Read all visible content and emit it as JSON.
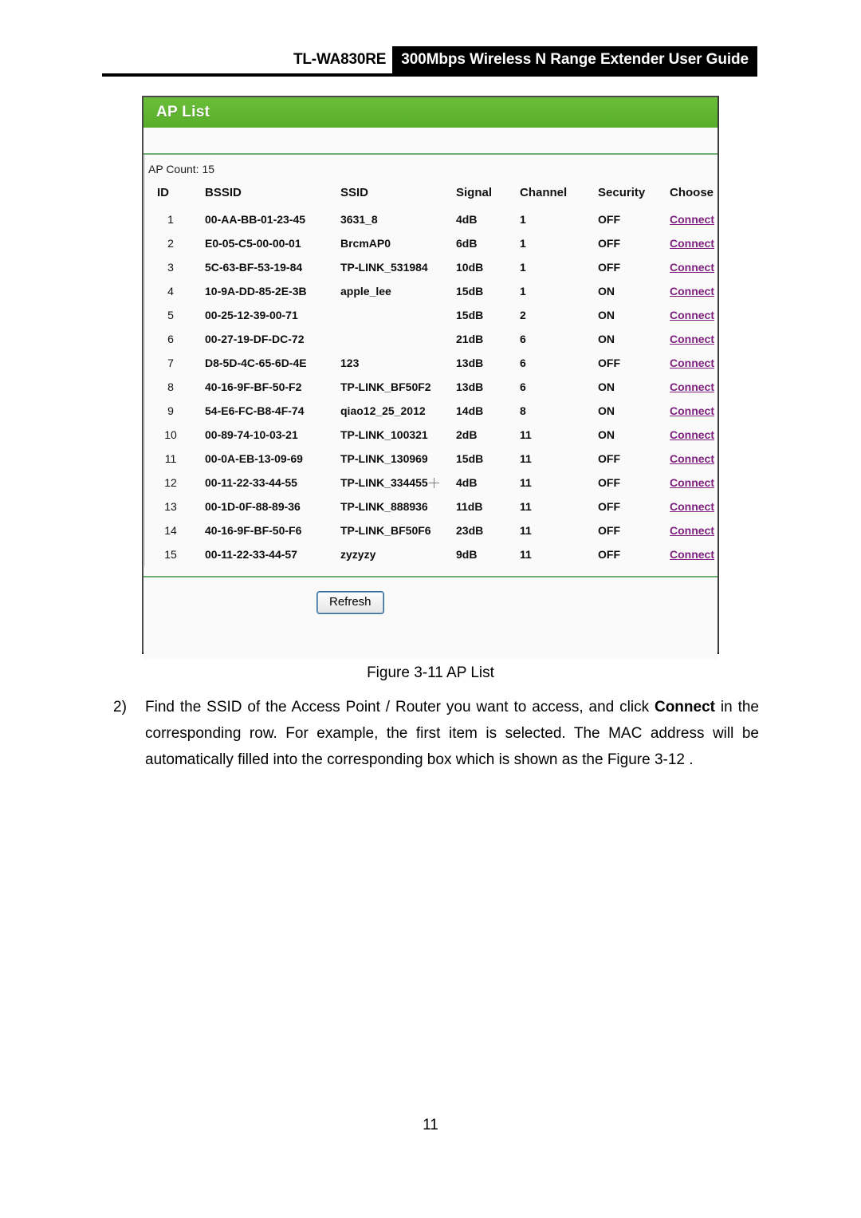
{
  "header": {
    "model": "TL-WA830RE",
    "title": "300Mbps Wireless N Range Extender User Guide"
  },
  "panel": {
    "title": "AP List",
    "ap_count_label": "AP Count: 15",
    "columns": {
      "id": "ID",
      "bssid": "BSSID",
      "ssid": "SSID",
      "signal": "Signal",
      "channel": "Channel",
      "security": "Security",
      "choose": "Choose"
    },
    "rows": [
      {
        "id": "1",
        "bssid": "00-AA-BB-01-23-45",
        "ssid": "3631_8",
        "signal": "4dB",
        "channel": "1",
        "security": "OFF",
        "choose": "Connect"
      },
      {
        "id": "2",
        "bssid": "E0-05-C5-00-00-01",
        "ssid": "BrcmAP0",
        "signal": "6dB",
        "channel": "1",
        "security": "OFF",
        "choose": "Connect"
      },
      {
        "id": "3",
        "bssid": "5C-63-BF-53-19-84",
        "ssid": "TP-LINK_531984",
        "signal": "10dB",
        "channel": "1",
        "security": "OFF",
        "choose": "Connect"
      },
      {
        "id": "4",
        "bssid": "10-9A-DD-85-2E-3B",
        "ssid": "apple_lee",
        "signal": "15dB",
        "channel": "1",
        "security": "ON",
        "choose": "Connect"
      },
      {
        "id": "5",
        "bssid": "00-25-12-39-00-71",
        "ssid": "",
        "signal": "15dB",
        "channel": "2",
        "security": "ON",
        "choose": "Connect"
      },
      {
        "id": "6",
        "bssid": "00-27-19-DF-DC-72",
        "ssid": "",
        "signal": "21dB",
        "channel": "6",
        "security": "ON",
        "choose": "Connect"
      },
      {
        "id": "7",
        "bssid": "D8-5D-4C-65-6D-4E",
        "ssid": "123",
        "signal": "13dB",
        "channel": "6",
        "security": "OFF",
        "choose": "Connect"
      },
      {
        "id": "8",
        "bssid": "40-16-9F-BF-50-F2",
        "ssid": "TP-LINK_BF50F2",
        "signal": "13dB",
        "channel": "6",
        "security": "ON",
        "choose": "Connect"
      },
      {
        "id": "9",
        "bssid": "54-E6-FC-B8-4F-74",
        "ssid": "qiao12_25_2012",
        "signal": "14dB",
        "channel": "8",
        "security": "ON",
        "choose": "Connect"
      },
      {
        "id": "10",
        "bssid": "00-89-74-10-03-21",
        "ssid": "TP-LINK_100321",
        "signal": "2dB",
        "channel": "11",
        "security": "ON",
        "choose": "Connect"
      },
      {
        "id": "11",
        "bssid": "00-0A-EB-13-09-69",
        "ssid": "TP-LINK_130969",
        "signal": "15dB",
        "channel": "11",
        "security": "OFF",
        "choose": "Connect"
      },
      {
        "id": "12",
        "bssid": "00-11-22-33-44-55",
        "ssid": "TP-LINK_334455",
        "signal": "4dB",
        "channel": "11",
        "security": "OFF",
        "choose": "Connect"
      },
      {
        "id": "13",
        "bssid": "00-1D-0F-88-89-36",
        "ssid": "TP-LINK_888936",
        "signal": "11dB",
        "channel": "11",
        "security": "OFF",
        "choose": "Connect"
      },
      {
        "id": "14",
        "bssid": "40-16-9F-BF-50-F6",
        "ssid": "TP-LINK_BF50F6",
        "signal": "23dB",
        "channel": "11",
        "security": "OFF",
        "choose": "Connect"
      },
      {
        "id": "15",
        "bssid": "00-11-22-33-44-57",
        "ssid": "zyzyzy",
        "signal": "9dB",
        "channel": "11",
        "security": "OFF",
        "choose": "Connect"
      }
    ],
    "refresh_label": "Refresh",
    "title_bar_color": "#5eb530",
    "link_color": "#7d1f7d"
  },
  "figure": {
    "caption": "Figure 3-11 AP List"
  },
  "instruction": {
    "marker": "2)",
    "text_before": "Find the SSID of the Access Point / Router you want to access, and click ",
    "bold_word": "Connect",
    "text_after": " in the corresponding row. For example, the first item is selected. The MAC address will be automatically filled into the corresponding box which is shown as the Figure 3-12 ."
  },
  "footer": {
    "page_number": "11"
  }
}
